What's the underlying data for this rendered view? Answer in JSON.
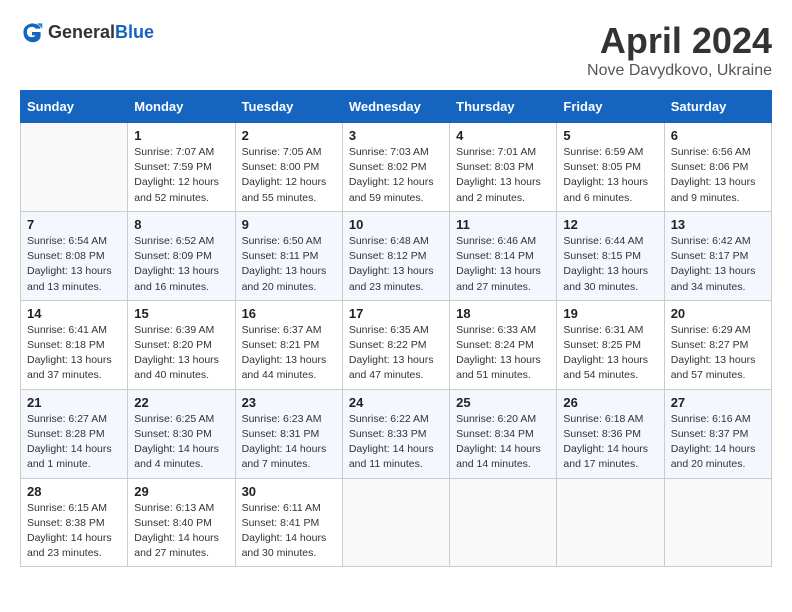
{
  "header": {
    "logo_general": "General",
    "logo_blue": "Blue",
    "month_year": "April 2024",
    "location": "Nove Davydkovo, Ukraine"
  },
  "weekdays": [
    "Sunday",
    "Monday",
    "Tuesday",
    "Wednesday",
    "Thursday",
    "Friday",
    "Saturday"
  ],
  "weeks": [
    [
      {
        "day": "",
        "info": ""
      },
      {
        "day": "1",
        "info": "Sunrise: 7:07 AM\nSunset: 7:59 PM\nDaylight: 12 hours\nand 52 minutes."
      },
      {
        "day": "2",
        "info": "Sunrise: 7:05 AM\nSunset: 8:00 PM\nDaylight: 12 hours\nand 55 minutes."
      },
      {
        "day": "3",
        "info": "Sunrise: 7:03 AM\nSunset: 8:02 PM\nDaylight: 12 hours\nand 59 minutes."
      },
      {
        "day": "4",
        "info": "Sunrise: 7:01 AM\nSunset: 8:03 PM\nDaylight: 13 hours\nand 2 minutes."
      },
      {
        "day": "5",
        "info": "Sunrise: 6:59 AM\nSunset: 8:05 PM\nDaylight: 13 hours\nand 6 minutes."
      },
      {
        "day": "6",
        "info": "Sunrise: 6:56 AM\nSunset: 8:06 PM\nDaylight: 13 hours\nand 9 minutes."
      }
    ],
    [
      {
        "day": "7",
        "info": "Sunrise: 6:54 AM\nSunset: 8:08 PM\nDaylight: 13 hours\nand 13 minutes."
      },
      {
        "day": "8",
        "info": "Sunrise: 6:52 AM\nSunset: 8:09 PM\nDaylight: 13 hours\nand 16 minutes."
      },
      {
        "day": "9",
        "info": "Sunrise: 6:50 AM\nSunset: 8:11 PM\nDaylight: 13 hours\nand 20 minutes."
      },
      {
        "day": "10",
        "info": "Sunrise: 6:48 AM\nSunset: 8:12 PM\nDaylight: 13 hours\nand 23 minutes."
      },
      {
        "day": "11",
        "info": "Sunrise: 6:46 AM\nSunset: 8:14 PM\nDaylight: 13 hours\nand 27 minutes."
      },
      {
        "day": "12",
        "info": "Sunrise: 6:44 AM\nSunset: 8:15 PM\nDaylight: 13 hours\nand 30 minutes."
      },
      {
        "day": "13",
        "info": "Sunrise: 6:42 AM\nSunset: 8:17 PM\nDaylight: 13 hours\nand 34 minutes."
      }
    ],
    [
      {
        "day": "14",
        "info": "Sunrise: 6:41 AM\nSunset: 8:18 PM\nDaylight: 13 hours\nand 37 minutes."
      },
      {
        "day": "15",
        "info": "Sunrise: 6:39 AM\nSunset: 8:20 PM\nDaylight: 13 hours\nand 40 minutes."
      },
      {
        "day": "16",
        "info": "Sunrise: 6:37 AM\nSunset: 8:21 PM\nDaylight: 13 hours\nand 44 minutes."
      },
      {
        "day": "17",
        "info": "Sunrise: 6:35 AM\nSunset: 8:22 PM\nDaylight: 13 hours\nand 47 minutes."
      },
      {
        "day": "18",
        "info": "Sunrise: 6:33 AM\nSunset: 8:24 PM\nDaylight: 13 hours\nand 51 minutes."
      },
      {
        "day": "19",
        "info": "Sunrise: 6:31 AM\nSunset: 8:25 PM\nDaylight: 13 hours\nand 54 minutes."
      },
      {
        "day": "20",
        "info": "Sunrise: 6:29 AM\nSunset: 8:27 PM\nDaylight: 13 hours\nand 57 minutes."
      }
    ],
    [
      {
        "day": "21",
        "info": "Sunrise: 6:27 AM\nSunset: 8:28 PM\nDaylight: 14 hours\nand 1 minute."
      },
      {
        "day": "22",
        "info": "Sunrise: 6:25 AM\nSunset: 8:30 PM\nDaylight: 14 hours\nand 4 minutes."
      },
      {
        "day": "23",
        "info": "Sunrise: 6:23 AM\nSunset: 8:31 PM\nDaylight: 14 hours\nand 7 minutes."
      },
      {
        "day": "24",
        "info": "Sunrise: 6:22 AM\nSunset: 8:33 PM\nDaylight: 14 hours\nand 11 minutes."
      },
      {
        "day": "25",
        "info": "Sunrise: 6:20 AM\nSunset: 8:34 PM\nDaylight: 14 hours\nand 14 minutes."
      },
      {
        "day": "26",
        "info": "Sunrise: 6:18 AM\nSunset: 8:36 PM\nDaylight: 14 hours\nand 17 minutes."
      },
      {
        "day": "27",
        "info": "Sunrise: 6:16 AM\nSunset: 8:37 PM\nDaylight: 14 hours\nand 20 minutes."
      }
    ],
    [
      {
        "day": "28",
        "info": "Sunrise: 6:15 AM\nSunset: 8:38 PM\nDaylight: 14 hours\nand 23 minutes."
      },
      {
        "day": "29",
        "info": "Sunrise: 6:13 AM\nSunset: 8:40 PM\nDaylight: 14 hours\nand 27 minutes."
      },
      {
        "day": "30",
        "info": "Sunrise: 6:11 AM\nSunset: 8:41 PM\nDaylight: 14 hours\nand 30 minutes."
      },
      {
        "day": "",
        "info": ""
      },
      {
        "day": "",
        "info": ""
      },
      {
        "day": "",
        "info": ""
      },
      {
        "day": "",
        "info": ""
      }
    ]
  ]
}
